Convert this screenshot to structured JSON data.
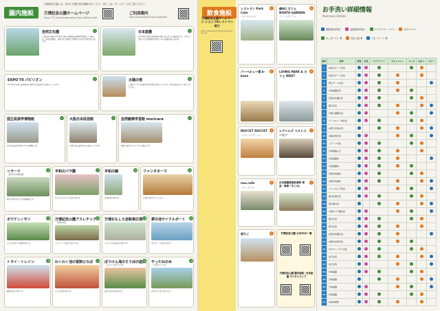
{
  "panel_facilities": {
    "title": "園内施設",
    "subtitle": "Expo '70 Commemorative Park official web",
    "note": "万博記念公園には、ほかにも魅力的な施設がたくさん！ 詳しくは、ホームページをご覧ください。",
    "hp_label": "万博記念公園ホームページ",
    "hp_url": "https://www.expo70-park.jp/",
    "news_label": "ご利用案内",
    "news_url": "https://www.expo70-park.jp/guide/",
    "items": [
      {
        "no": "1",
        "name": "自然文化園",
        "sub": "",
        "text": "万博記念公園は1970年の日本万国博覧会の跡地を整備した公園です。自然文化園は、緑あふれる園内で四季折々の花や自然を楽しめます。"
      },
      {
        "no": "2",
        "name": "日本庭園",
        "sub": "",
        "text": "1970年の日本万国博覧会の際に造られた日本庭園です。上代から近代までの作庭様式を取り入れた庭園を楽しめます。"
      },
      {
        "no": "3",
        "name": "EXPO'70 パビリオン",
        "sub": "",
        "text": "1970年の日本万国博覧会の資料や記念品などを展示しています。"
      },
      {
        "no": "4",
        "name": "太陽の塔",
        "sub": "",
        "text": "万博のシンボル太陽の塔の内部を公開しています。生命の樹などをご覧いただけます。"
      },
      {
        "no": "5",
        "name": "国立民族学博物館",
        "sub": "",
        "text": "世界の民族文化を紹介する博物館です。"
      },
      {
        "no": "6",
        "name": "大阪日本民芸館",
        "sub": "",
        "text": "日本の民芸品を中心に展示しています。"
      },
      {
        "no": "7",
        "name": "自然観察学習館 moricara",
        "sub": "",
        "text": "園内の自然について学べる施設です。"
      },
      {
        "no": "8",
        "name": "ソラード",
        "sub": "（森の空中観察路）",
        "text": "樹木の中を歩ける空中観察路です。"
      },
      {
        "no": "9",
        "name": "平和のパラ園",
        "sub": "",
        "text": "色とりどりのバラが楽しめます。"
      },
      {
        "no": "10",
        "name": "平和の鐘",
        "sub": "",
        "text": "平和を願う鐘です。"
      },
      {
        "no": "11",
        "name": "ファンタヌーマ",
        "sub": "",
        "text": "万博の記念オブジェです。"
      },
      {
        "no": "12",
        "name": "ボウケンノモリ",
        "sub": "",
        "text": "子どもが遊べる冒険の森です。"
      },
      {
        "no": "13",
        "name": "万博記念公園アスレチック",
        "sub": "「冒険の森」",
        "text": "アスレチック遊具で遊べます。"
      },
      {
        "no": "14",
        "name": "万博おもしろ自転車広場",
        "sub": "",
        "text": "いろいろな自転車に乗れます。"
      },
      {
        "no": "15",
        "name": "夢の池サイクルボート",
        "sub": "",
        "text": "池でボートを楽しめます。"
      },
      {
        "no": "16",
        "name": "トライ・トレイン",
        "sub": "",
        "text": "園内を巡る列車です。"
      },
      {
        "no": "17",
        "name": "わくわく池の冒険ひろば",
        "sub": "",
        "text": "子どもの遊び場です。"
      },
      {
        "no": "18",
        "name": "ぼうけん滝のそうぼの遊具",
        "sub": "「エキスポあそび場」",
        "text": "遊具のある遊び場です。"
      },
      {
        "no": "19",
        "name": "やったねの木",
        "sub": "（大型すべり台）",
        "text": "大型すべり台で遊べます。"
      }
    ]
  },
  "panel_food": {
    "title": "飲食施設",
    "hp_label": "万博記念公園ホームページ ショップ&レストラン紹介",
    "url": "https://www.expo70-park.jp/cause/shop_fd/",
    "items": [
      {
        "no": "A",
        "name": "レストラン Park Cafe",
        "sub": "（パークカフェ）"
      },
      {
        "no": "B",
        "name": "森林とカフェ NORTH GARDEN",
        "sub": "（ノースガーデン）"
      },
      {
        "no": "C",
        "name": "バーベキュー場 b-base",
        "sub": ""
      },
      {
        "no": "D",
        "name": "LIVING PARK & カフェ WEST",
        "sub": ""
      },
      {
        "no": "E",
        "name": "NUCCET NUCCET",
        "sub": "（ナゲットナゲット）"
      },
      {
        "no": "F",
        "name": "シアトルズ ベストコーヒー",
        "sub": ""
      },
      {
        "no": "G",
        "name": "テーブル ホームズ ジェラフル",
        "sub": ""
      },
      {
        "no": "H",
        "name": "neu.cafe",
        "sub": "（ノイ カフェ）"
      },
      {
        "no": "I",
        "name": "日本庭園茶室休憩所 茶店・喫茶「おこみ」",
        "sub": ""
      },
      {
        "no": "J",
        "name": "森の茶食 グリルみんばと",
        "sub": ""
      },
      {
        "no": "K",
        "name": "宙たこ",
        "sub": ""
      }
    ],
    "sns_label": "万博記念公園 公式SNS一覧",
    "map_label": "万博記念公園 園内地図・日本庭園 デジタルマップ"
  },
  "panel_restroom": {
    "title": "お手洗い詳細情報",
    "subtitle": "Restroom Details",
    "legend": [
      {
        "label": "男性用お手洗い",
        "color": "#1f6fb5"
      },
      {
        "label": "女性用お手洗い",
        "color": "#c84aa0"
      },
      {
        "label": "バリアフリー トイレ",
        "color": "#3e8f3a"
      },
      {
        "label": "オストメイト",
        "color": "#e0781e"
      },
      {
        "label": "キッズトイレ 有",
        "color": "#3e8f3a"
      },
      {
        "label": "おむつ台 有",
        "color": "#e0781e"
      },
      {
        "label": "ベビーシート 有",
        "color": "#1f6fb5"
      }
    ],
    "col_headers": [
      "番号",
      "名称",
      "男性",
      "女性",
      "バリアフリー",
      "オストメイト",
      "キッズ",
      "おむつ",
      "ベビー"
    ],
    "rows": [
      {
        "no": "1",
        "name": "中央口ゲート付近"
      },
      {
        "no": "2",
        "name": "中央口ゲート付近"
      },
      {
        "no": "3",
        "name": "東口ゲート付近"
      },
      {
        "no": "4",
        "name": "日本庭園付近"
      },
      {
        "no": "5",
        "name": "自然文化園付近"
      },
      {
        "no": "6",
        "name": "西口付近"
      },
      {
        "no": "7",
        "name": "万博公園駅付近"
      },
      {
        "no": "8",
        "name": "バーベキュー場付近"
      },
      {
        "no": "9",
        "name": "お祭り広場付近"
      },
      {
        "no": "10",
        "name": "太陽の塔付近"
      },
      {
        "no": "11",
        "name": "ソラード付近"
      },
      {
        "no": "12",
        "name": "日本庭園入口"
      },
      {
        "no": "13",
        "name": "日本庭園内"
      },
      {
        "no": "14",
        "name": "日本庭園内"
      },
      {
        "no": "15",
        "name": "自然文化園内"
      },
      {
        "no": "16",
        "name": "自然文化園内"
      },
      {
        "no": "17",
        "name": "ファンタジア周辺"
      },
      {
        "no": "18",
        "name": "東の広場付近"
      },
      {
        "no": "19",
        "name": "西大路付近"
      },
      {
        "no": "20",
        "name": "平和のバラ園付近"
      },
      {
        "no": "21",
        "name": "西口付近"
      },
      {
        "no": "22",
        "name": "東口付近"
      },
      {
        "no": "23",
        "name": "自然文化園付近"
      },
      {
        "no": "24",
        "name": "太陽の広場付近"
      },
      {
        "no": "25",
        "name": "ボウケンノモリ付近"
      },
      {
        "no": "26",
        "name": "北口付近"
      },
      {
        "no": "27",
        "name": "北口付近"
      },
      {
        "no": "28",
        "name": "日本庭園"
      },
      {
        "no": "29",
        "name": "日本庭園"
      },
      {
        "no": "30",
        "name": "日本庭園"
      },
      {
        "no": "31",
        "name": "日本庭園"
      },
      {
        "no": "32",
        "name": "中央休憩所"
      }
    ]
  }
}
